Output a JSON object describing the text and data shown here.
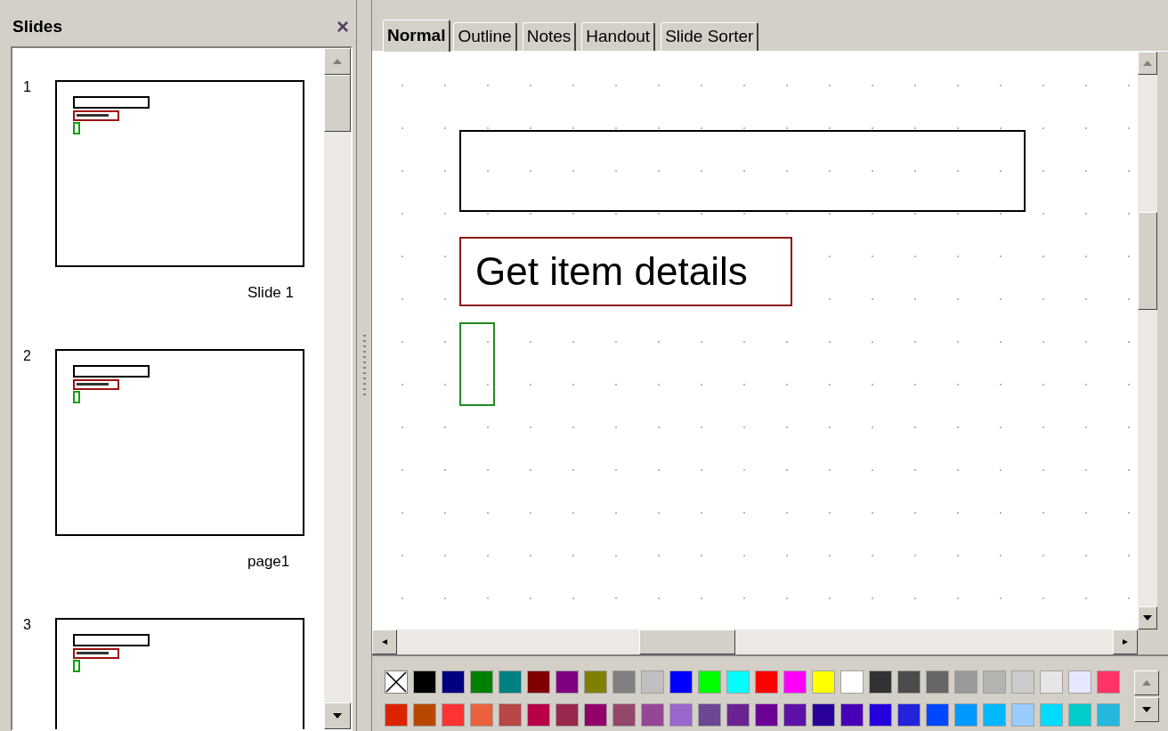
{
  "slides_pane": {
    "title": "Slides",
    "close": "×",
    "slides": [
      {
        "number": "1",
        "label": "Slide 1"
      },
      {
        "number": "2",
        "label": "page1"
      },
      {
        "number": "3"
      }
    ]
  },
  "tabs": [
    {
      "label": "Normal",
      "selected": true
    },
    {
      "label": "Outline",
      "selected": false
    },
    {
      "label": "Notes",
      "selected": false
    },
    {
      "label": "Handout",
      "selected": false
    },
    {
      "label": "Slide Sorter",
      "selected": false
    }
  ],
  "slide": {
    "text_box": "Get item details"
  },
  "palette": [
    {
      "kind": "none"
    },
    {
      "color": "#000000"
    },
    {
      "color": "#000080"
    },
    {
      "color": "#008000"
    },
    {
      "color": "#008080"
    },
    {
      "color": "#800000"
    },
    {
      "color": "#800080"
    },
    {
      "color": "#808000"
    },
    {
      "color": "#808080"
    },
    {
      "color": "#c0c0c0"
    },
    {
      "color": "#0000ff"
    },
    {
      "color": "#00ff00"
    },
    {
      "color": "#00ffff"
    },
    {
      "color": "#ff0000"
    },
    {
      "color": "#ff00ff"
    },
    {
      "color": "#ffff00"
    },
    {
      "color": "#ffffff"
    },
    {
      "color": "#333333"
    },
    {
      "color": "#4c4c4c"
    },
    {
      "color": "#666666"
    },
    {
      "color": "#999999"
    },
    {
      "color": "#b3b3b3"
    },
    {
      "color": "#cccccc"
    },
    {
      "color": "#e6e6e6"
    },
    {
      "color": "#e6e6ff"
    },
    {
      "color": "#ff3366"
    },
    {
      "color": "#dc2300"
    },
    {
      "color": "#b84700"
    },
    {
      "color": "#ff3333"
    },
    {
      "color": "#eb613d"
    },
    {
      "color": "#b84747"
    },
    {
      "color": "#b80047"
    },
    {
      "color": "#99284c"
    },
    {
      "color": "#94006b"
    },
    {
      "color": "#94476b"
    },
    {
      "color": "#944794"
    },
    {
      "color": "#9966cc"
    },
    {
      "color": "#6b4794"
    },
    {
      "color": "#6b2394"
    },
    {
      "color": "#6b0094"
    },
    {
      "color": "#5e11a6"
    },
    {
      "color": "#280099"
    },
    {
      "color": "#4700b8"
    },
    {
      "color": "#2300dc"
    },
    {
      "color": "#2323dc"
    },
    {
      "color": "#0047ff"
    },
    {
      "color": "#0099ff"
    },
    {
      "color": "#00b8ff"
    },
    {
      "color": "#99ccff"
    },
    {
      "color": "#00dcff"
    },
    {
      "color": "#00cccc"
    },
    {
      "color": "#23b8dc"
    }
  ]
}
